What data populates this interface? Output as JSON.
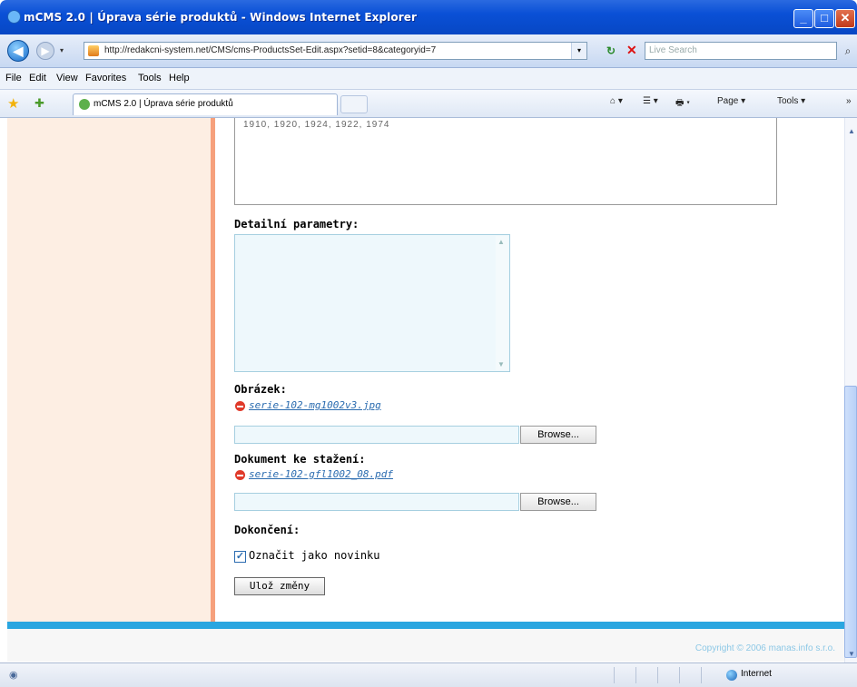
{
  "window": {
    "title": "mCMS 2.0 | Úprava série produktů - Windows Internet Explorer",
    "minimize": "_",
    "maximize": "□",
    "close": "✕"
  },
  "nav": {
    "back": "◀",
    "forward": "▶",
    "forward_drop": "▾",
    "url": "http://redakcni-system.net/CMS/cms-ProductsSet-Edit.aspx?setid=8&categoryid=7",
    "addr_drop": "▾",
    "refresh": "↻",
    "stop": "✕",
    "search_placeholder": "Live Search",
    "search_btn": "⌕"
  },
  "menu": [
    "File",
    "Edit",
    "View",
    "Favorites",
    "Tools",
    "Help"
  ],
  "tabs": {
    "favorites_star": "★",
    "add_favorites": "✚",
    "active_tab": "mCMS 2.0 | Úprava série produktů",
    "toolbar": [
      "⌂ ▾",
      "☰ ▾",
      "🖶 ▾",
      "Page ▾",
      "Tools ▾",
      "»"
    ]
  },
  "form": {
    "prev_textarea_partial": "1910, 1920, 1924, 1922, 1974",
    "detail_label": "Detailní parametry:",
    "image_label": "Obrázek:",
    "image_file": "serie-102-mg1002v3.jpg",
    "browse1": "Browse...",
    "doc_label": "Dokument ke stažení:",
    "doc_file": "serie-102-gfl1002_08.pdf",
    "browse2": "Browse...",
    "finish_label": "Dokončení:",
    "novinka_checked": "✓",
    "novinka_label": "Označit jako novinku",
    "save_button": "Ulož změny"
  },
  "footer": {
    "copyright": "Copyright © 2006 manas.info s.r.o."
  },
  "status": {
    "zone": "Internet"
  },
  "colors": {
    "title_bar": "#0a50d6",
    "left_column": "#fdeee3",
    "left_border": "#f6a07c",
    "footer_bar": "#2aa6e0",
    "link": "#2b6cb0"
  }
}
